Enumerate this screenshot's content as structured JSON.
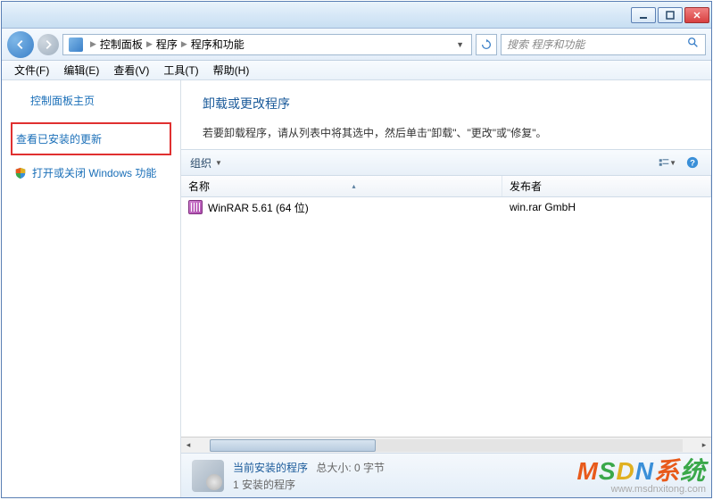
{
  "breadcrumb": {
    "items": [
      "控制面板",
      "程序",
      "程序和功能"
    ]
  },
  "search": {
    "placeholder": "搜索 程序和功能"
  },
  "menu": {
    "file": "文件(F)",
    "edit": "编辑(E)",
    "view": "查看(V)",
    "tools": "工具(T)",
    "help": "帮助(H)"
  },
  "sidebar": {
    "home": "控制面板主页",
    "updates": "查看已安装的更新",
    "windows_features": "打开或关闭 Windows 功能"
  },
  "content": {
    "title": "卸载或更改程序",
    "description": "若要卸载程序，请从列表中将其选中，然后单击\"卸载\"、\"更改\"或\"修复\"。"
  },
  "toolbar": {
    "organize": "组织"
  },
  "table": {
    "col_name": "名称",
    "col_publisher": "发布者",
    "rows": [
      {
        "name": "WinRAR 5.61 (64 位)",
        "publisher": "win.rar GmbH"
      }
    ]
  },
  "status": {
    "title": "当前安装的程序",
    "size_label": "总大小:",
    "size_value": "0 字节",
    "count": "1 安装的程序"
  },
  "watermark": {
    "main": "MSDN系统",
    "sub": "www.msdnxitong.com"
  }
}
